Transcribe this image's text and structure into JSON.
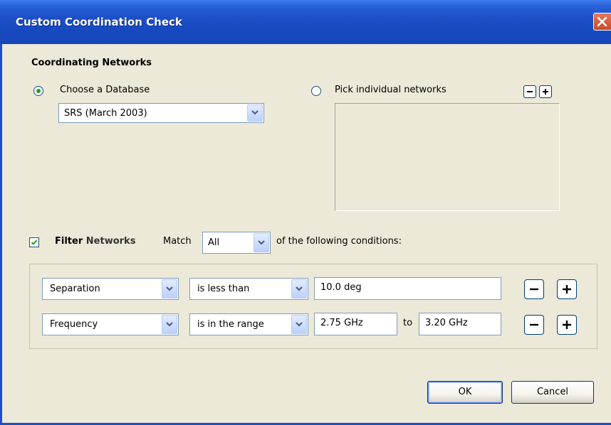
{
  "window": {
    "title": "Custom Coordination Check"
  },
  "coordinating": {
    "section_title": "Coordinating Networks",
    "database_option": {
      "label": "Choose a Database",
      "selected": true
    },
    "database_combo": {
      "value": "SRS (March 2003)"
    },
    "individual_option": {
      "label": "Pick individual networks",
      "selected": false
    },
    "individual_list": {
      "items": []
    }
  },
  "filter": {
    "checked": true,
    "label_bold": "Filter",
    "label_rest": "Networks",
    "match_label": "Match",
    "match_value": "All",
    "suffix": "of the following conditions:",
    "conditions": [
      {
        "field": "Separation",
        "operator": "is less than",
        "value": "10.0 deg"
      },
      {
        "field": "Frequency",
        "operator": "is in the range",
        "from": "2.75 GHz",
        "to_label": "to",
        "to": "3.20 GHz"
      }
    ]
  },
  "footer": {
    "ok_label": "OK",
    "cancel_label": "Cancel"
  },
  "icons": {
    "minus": "minus-icon",
    "plus": "plus-icon",
    "dropdown": "chevron-down-icon",
    "close": "close-icon"
  }
}
